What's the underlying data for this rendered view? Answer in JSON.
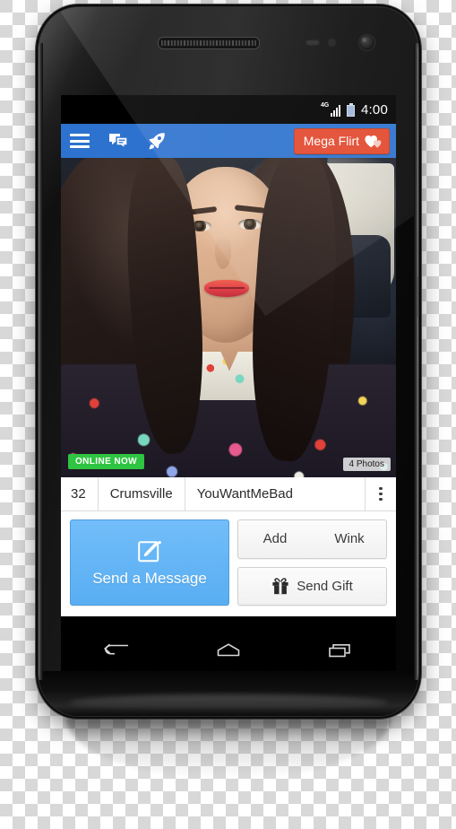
{
  "status_bar": {
    "network_label": "4G",
    "signal_icon": "signal-bars-icon",
    "battery_icon": "battery-icon",
    "clock": "4:00"
  },
  "app_header": {
    "menu_icon": "hamburger-menu-icon",
    "messages_icon": "messages-icon",
    "boost_icon": "rocket-icon",
    "mega_flirt_label": "Mega Flirt",
    "mega_flirt_icon": "hearts-icon",
    "background_color": "#2d72ce",
    "mega_flirt_color": "#e2492e"
  },
  "photo": {
    "online_badge": "ONLINE NOW",
    "online_badge_color": "#2fc442",
    "photo_count_badge": "4 Photos"
  },
  "profile": {
    "age": "32",
    "location": "Crumsville",
    "username": "YouWantMeBad",
    "overflow_icon": "overflow-menu-icon"
  },
  "actions": {
    "send_message_label": "Send a Message",
    "send_message_icon": "compose-icon",
    "send_message_color": "#63b5f6",
    "add_label": "Add",
    "wink_label": "Wink",
    "send_gift_label": "Send Gift",
    "send_gift_icon": "gift-icon"
  },
  "nav_bar": {
    "back_icon": "back-arrow-icon",
    "home_icon": "home-icon",
    "recents_icon": "recent-apps-icon"
  }
}
